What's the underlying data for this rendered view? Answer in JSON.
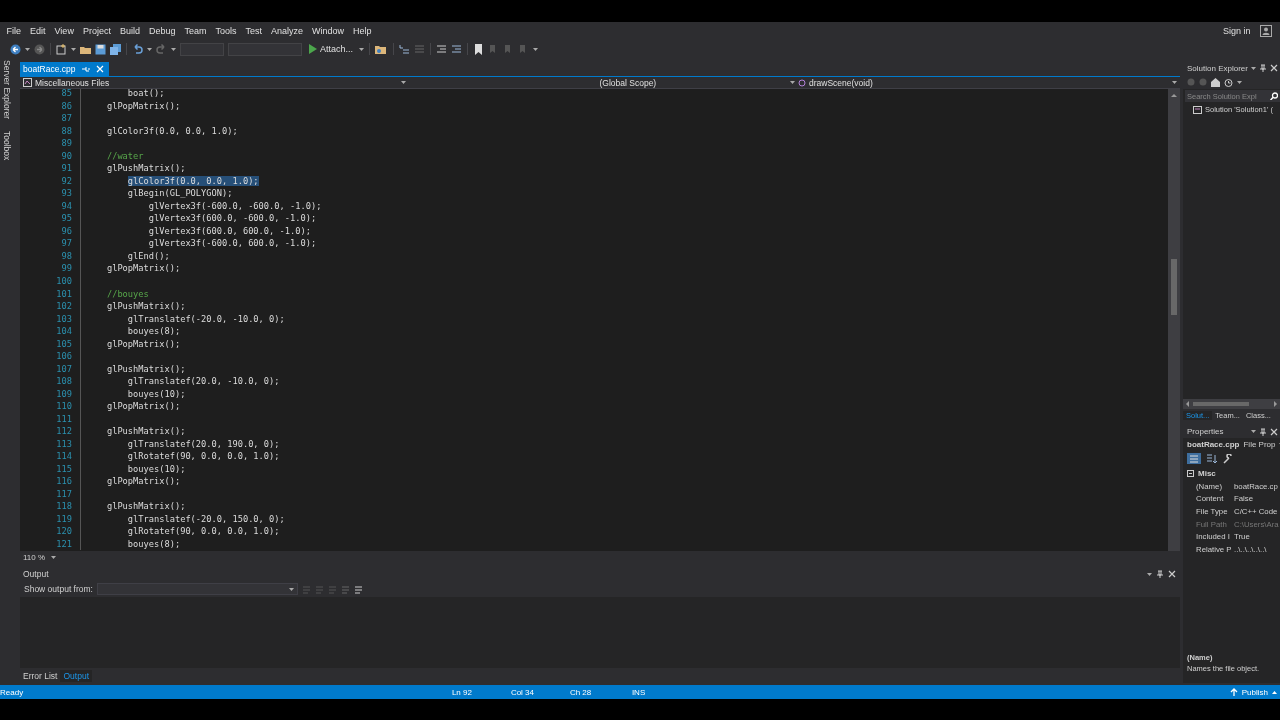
{
  "menu": [
    "File",
    "Edit",
    "View",
    "Project",
    "Build",
    "Debug",
    "Team",
    "Tools",
    "Test",
    "Analyze",
    "Window",
    "Help"
  ],
  "account": {
    "label": "Sign in"
  },
  "toolbar": {
    "attach_label": "Attach..."
  },
  "side_tabs": [
    "Server Explorer",
    "Toolbox"
  ],
  "document_tabs": [
    {
      "label": "boatRace.cpp",
      "selected": true
    }
  ],
  "nav_bar": {
    "project": "Miscellaneous Files",
    "scope": "(Global Scope)",
    "member": "drawScene(void)"
  },
  "code_lines": [
    {
      "number": "85",
      "text": "        boat();",
      "kind": "code",
      "selected": false
    },
    {
      "number": "86",
      "text": "    glPopMatrix();",
      "kind": "code",
      "selected": false
    },
    {
      "number": "87",
      "kind": "blank",
      "selected": false
    },
    {
      "number": "88",
      "text": "    glColor3f(0.0, 0.0, 1.0);",
      "kind": "code",
      "selected": false
    },
    {
      "number": "89",
      "kind": "blank",
      "selected": false
    },
    {
      "number": "90",
      "text": "    //water",
      "kind": "comment",
      "selected": false
    },
    {
      "number": "91",
      "text": "    glPushMatrix();",
      "kind": "code",
      "selected": false
    },
    {
      "number": "92",
      "text": "        glColor3f(0.0, 0.0, 1.0);",
      "kind": "code",
      "selected": true
    },
    {
      "number": "93",
      "text": "        glBegin(GL_POLYGON);",
      "kind": "code",
      "selected": false
    },
    {
      "number": "94",
      "text": "            glVertex3f(-600.0, -600.0, -1.0);",
      "kind": "code",
      "selected": false
    },
    {
      "number": "95",
      "text": "            glVertex3f(600.0, -600.0, -1.0);",
      "kind": "code",
      "selected": false
    },
    {
      "number": "96",
      "text": "            glVertex3f(600.0, 600.0, -1.0);",
      "kind": "code",
      "selected": false
    },
    {
      "number": "97",
      "text": "            glVertex3f(-600.0, 600.0, -1.0);",
      "kind": "code",
      "selected": false
    },
    {
      "number": "98",
      "text": "        glEnd();",
      "kind": "code",
      "selected": false
    },
    {
      "number": "99",
      "text": "    glPopMatrix();",
      "kind": "code",
      "selected": false
    },
    {
      "number": "100",
      "kind": "blank",
      "selected": false
    },
    {
      "number": "101",
      "text": "    //bouyes",
      "kind": "comment",
      "selected": false
    },
    {
      "number": "102",
      "text": "    glPushMatrix();",
      "kind": "code",
      "selected": false
    },
    {
      "number": "103",
      "text": "        glTranslatef(-20.0, -10.0, 0);",
      "kind": "code",
      "selected": false
    },
    {
      "number": "104",
      "text": "        bouyes(8);",
      "kind": "code",
      "selected": false
    },
    {
      "number": "105",
      "text": "    glPopMatrix();",
      "kind": "code",
      "selected": false
    },
    {
      "number": "106",
      "kind": "blank",
      "selected": false
    },
    {
      "number": "107",
      "text": "    glPushMatrix();",
      "kind": "code",
      "selected": false
    },
    {
      "number": "108",
      "text": "        glTranslatef(20.0, -10.0, 0);",
      "kind": "code",
      "selected": false
    },
    {
      "number": "109",
      "text": "        bouyes(10);",
      "kind": "code",
      "selected": false
    },
    {
      "number": "110",
      "text": "    glPopMatrix();",
      "kind": "code",
      "selected": false
    },
    {
      "number": "111",
      "kind": "blank",
      "selected": false
    },
    {
      "number": "112",
      "text": "    glPushMatrix();",
      "kind": "code",
      "selected": false
    },
    {
      "number": "113",
      "text": "        glTranslatef(20.0, 190.0, 0);",
      "kind": "code",
      "selected": false
    },
    {
      "number": "114",
      "text": "        glRotatef(90, 0.0, 0.0, 1.0);",
      "kind": "code",
      "selected": false
    },
    {
      "number": "115",
      "text": "        bouyes(10);",
      "kind": "code",
      "selected": false
    },
    {
      "number": "116",
      "text": "    glPopMatrix();",
      "kind": "code",
      "selected": false
    },
    {
      "number": "117",
      "kind": "blank",
      "selected": false
    },
    {
      "number": "118",
      "text": "    glPushMatrix();",
      "kind": "code",
      "selected": false
    },
    {
      "number": "119",
      "text": "        glTranslatef(-20.0, 150.0, 0);",
      "kind": "code",
      "selected": false
    },
    {
      "number": "120",
      "text": "        glRotatef(90, 0.0, 0.0, 1.0);",
      "kind": "code",
      "selected": false
    },
    {
      "number": "121",
      "text": "        bouyes(8);",
      "kind": "code",
      "selected": false
    }
  ],
  "zoom": "110 %",
  "output": {
    "title": "Output",
    "show_output_from": "Show output from:",
    "tabs": [
      {
        "label": "Error List",
        "selected": false
      },
      {
        "label": "Output",
        "selected": true
      }
    ]
  },
  "solution_explorer": {
    "title": "Solution Explorer",
    "search_placeholder": "Search Solution Expl",
    "items": [
      {
        "label": "Solution 'Solution1' ("
      }
    ],
    "tabs": [
      {
        "label": "Solut...",
        "selected": true
      },
      {
        "label": "Team...",
        "selected": false
      },
      {
        "label": "Class...",
        "selected": false
      }
    ]
  },
  "properties": {
    "title": "Properties",
    "object": "boatRace.cpp",
    "object_type": "File Prop",
    "category": "Misc",
    "expanded": true,
    "rows": [
      {
        "name": "(Name)",
        "value": "boatRace.cp",
        "disabled": false
      },
      {
        "name": "Content",
        "value": "False",
        "disabled": false
      },
      {
        "name": "File Type",
        "value": "C/C++ Code",
        "disabled": false
      },
      {
        "name": "Full Path",
        "value": "C:\\Users\\Ara",
        "disabled": true
      },
      {
        "name": "Included I",
        "value": "True",
        "disabled": false
      },
      {
        "name": "Relative P",
        "value": "..\\..\\..\\..\\..\\",
        "disabled": false
      }
    ],
    "description_title": "(Name)",
    "description": "Names the file object."
  },
  "status_bar": {
    "message": "Ready",
    "line": "Ln 92",
    "column": "Col 34",
    "char": "Ch 28",
    "mode": "INS",
    "publish": "Publish"
  }
}
